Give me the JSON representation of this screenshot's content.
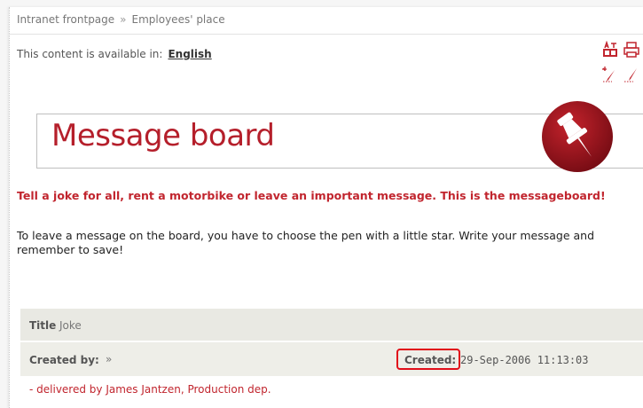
{
  "breadcrumb": {
    "items": [
      "Intranet frontpage",
      "Employees' place"
    ],
    "separator": "»"
  },
  "language": {
    "prefix": "This content is available in:",
    "current": "English"
  },
  "toolbar": {
    "icons": [
      "translate-icon",
      "print-icon",
      "new-item-pen-icon",
      "edit-pen-icon"
    ]
  },
  "header": {
    "title": "Message board",
    "accent_color": "#b51f2b"
  },
  "intro": {
    "lead": "Tell a joke for all, rent a motorbike or leave an important message. This is the messageboard!",
    "info": "To leave a message on the board, you have to choose the pen with a little star. Write your message and remember to save!"
  },
  "message": {
    "title_label": "Title",
    "title_value": "Joke",
    "created_by_label": "Created by:",
    "created_by_arrow": "»",
    "created_label": "Created:",
    "created_value": "29-Sep-2006 11:13:03",
    "delivered": "- delivered by James Jantzen, Production dep."
  }
}
